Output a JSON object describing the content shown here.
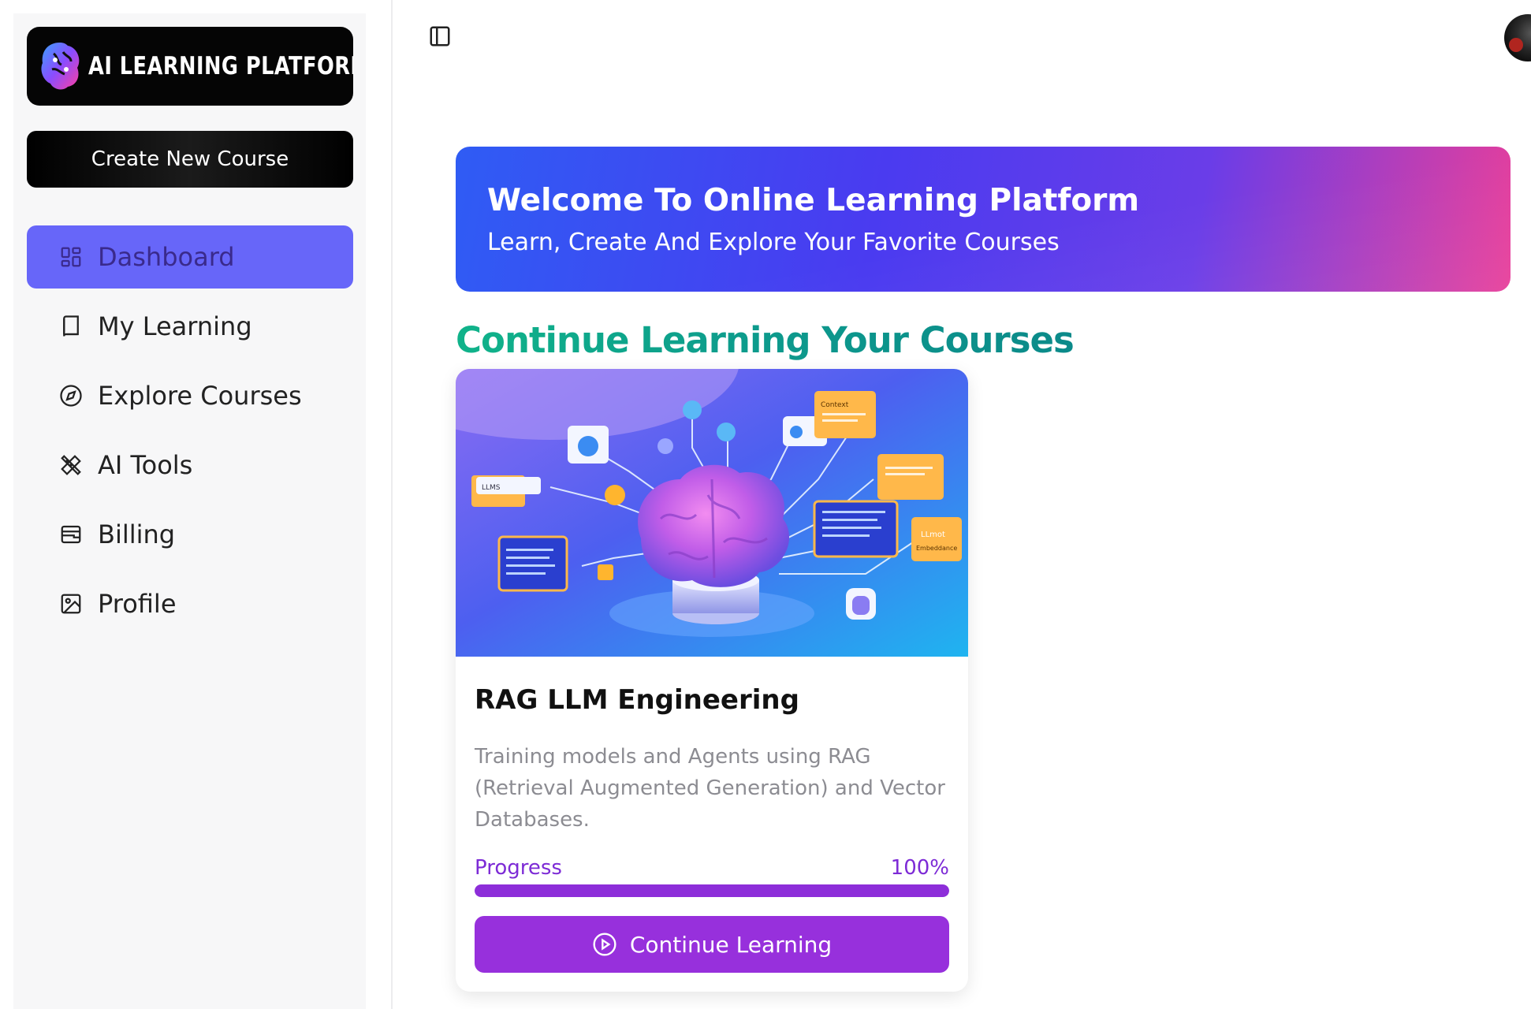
{
  "brand": {
    "logo_text": "AI LEARNING PLATFORM"
  },
  "sidebar": {
    "create_button": "Create New Course",
    "items": [
      {
        "label": "Dashboard",
        "icon": "layout-dashboard-icon",
        "active": true
      },
      {
        "label": "My Learning",
        "icon": "book-icon",
        "active": false
      },
      {
        "label": "Explore Courses",
        "icon": "compass-icon",
        "active": false
      },
      {
        "label": "AI Tools",
        "icon": "tools-icon",
        "active": false
      },
      {
        "label": "Billing",
        "icon": "wallet-icon",
        "active": false
      },
      {
        "label": "Profile",
        "icon": "image-icon",
        "active": false
      }
    ]
  },
  "header": {
    "toggle_icon": "panel-left-icon",
    "avatar": "user-avatar"
  },
  "banner": {
    "title": "Welcome To Online Learning Platform",
    "subtitle": "Learn, Create And Explore Your Favorite Courses"
  },
  "section": {
    "title": "Continue Learning Your Courses"
  },
  "course": {
    "title": "RAG LLM Engineering",
    "description": "Training models and Agents using RAG (Retrieval Augmented Generation) and Vector Databases.",
    "progress_label": "Progress",
    "progress_text": "100%",
    "progress_value": 1.0,
    "button_label": "Continue Learning",
    "image_labels": {
      "llms": "LLMS",
      "context": "Context",
      "llmot": "LLmot",
      "embedding": "Embeddance"
    }
  },
  "colors": {
    "accent_active": "#6766f9",
    "course_purple": "#9730dc",
    "section_title_green": "#10b38a",
    "banner_start": "#2f5cf4",
    "banner_end": "#e83e9a"
  }
}
